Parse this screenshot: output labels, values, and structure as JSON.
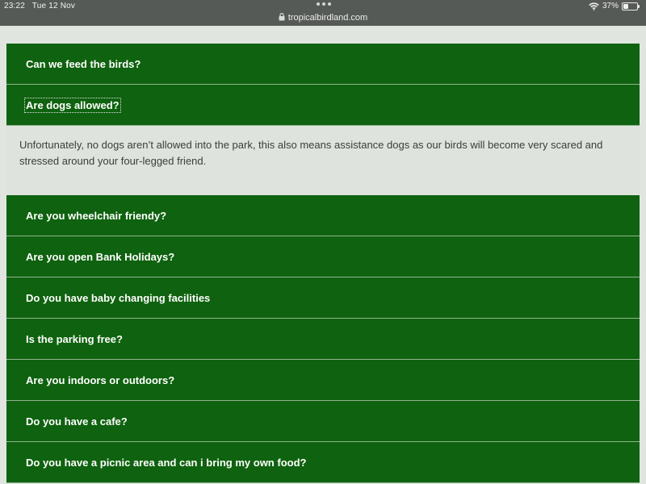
{
  "status_bar": {
    "time": "23:22",
    "date": "Tue 12 Nov",
    "url": "tropicalbirdland.com",
    "battery_percent_label": "37%",
    "battery_level": 0.37,
    "icons": [
      "more-dots-icon",
      "lock-icon",
      "wifi-icon",
      "battery-icon"
    ]
  },
  "faq": {
    "accent_color": "#0f620f",
    "items": [
      {
        "question": "Can we feed the birds?",
        "expanded": false
      },
      {
        "question": "Are dogs allowed?",
        "expanded": true,
        "focused": true,
        "answer": "Unfortunately, no dogs aren’t allowed into the park, this also means assistance dogs as our birds will become very scared and stressed around your four-legged friend."
      },
      {
        "question": "Are you wheelchair friendy?",
        "expanded": false
      },
      {
        "question": "Are you open Bank Holidays?",
        "expanded": false
      },
      {
        "question": "Do you have baby changing facilities",
        "expanded": false
      },
      {
        "question": "Is the parking free?",
        "expanded": false
      },
      {
        "question": "Are you indoors or outdoors?",
        "expanded": false
      },
      {
        "question": "Do you have a cafe?",
        "expanded": false
      },
      {
        "question": "Do you have a picnic area and can i bring my own food?",
        "expanded": false
      }
    ]
  }
}
